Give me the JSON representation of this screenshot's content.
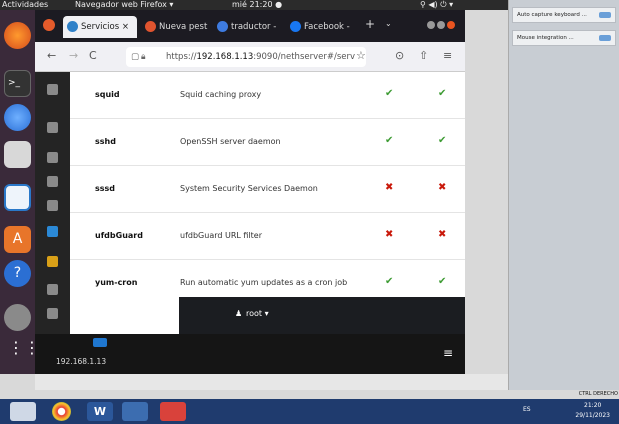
{
  "topbar": {
    "activities": "Actividades",
    "app_menu": "Navegador web Firefox ▾",
    "clock": "mié 21:20 ●",
    "tray": "⚲ ◀) ⏻ ▾"
  },
  "tabs": [
    {
      "label": "Servicios ×",
      "color": "#2f80c8"
    },
    {
      "label": "Nueva pest",
      "color": "#e0542f"
    },
    {
      "label": "traductor -",
      "color": "#3e7be0"
    },
    {
      "label": "Facebook -",
      "color": "#1877f2"
    }
  ],
  "tab_new": "+",
  "address": {
    "prefix": "https://",
    "host": "192.168.1.13",
    "rest": ":9090/nethserver#/serv"
  },
  "services": [
    {
      "name": "squid",
      "desc": "Squid caching proxy",
      "enabled": true,
      "running": true
    },
    {
      "name": "sshd",
      "desc": "OpenSSH server daemon",
      "enabled": true,
      "running": true
    },
    {
      "name": "sssd",
      "desc": "System Security Services Daemon",
      "enabled": false,
      "running": false
    },
    {
      "name": "ufdbGuard",
      "desc": "ufdbGuard URL filter",
      "enabled": false,
      "running": false
    },
    {
      "name": "yum-cron",
      "desc": "Run automatic yum updates as a cron job",
      "enabled": true,
      "running": true
    }
  ],
  "user_panel": {
    "user": "root ▾",
    "icon": "user-icon"
  },
  "bottom": {
    "host": "192.168.1.13",
    "menu": "≡"
  },
  "right_panel": {
    "options": [
      "Auto capture keyboard ...",
      "Mouse integration ..."
    ],
    "status": "CTRL DERECHO"
  },
  "taskbar": {
    "lang": "ES",
    "time": "21:20",
    "date": "29/11/2023"
  },
  "colors": {
    "ok": "#3f9c35",
    "fail": "#c9190b"
  }
}
